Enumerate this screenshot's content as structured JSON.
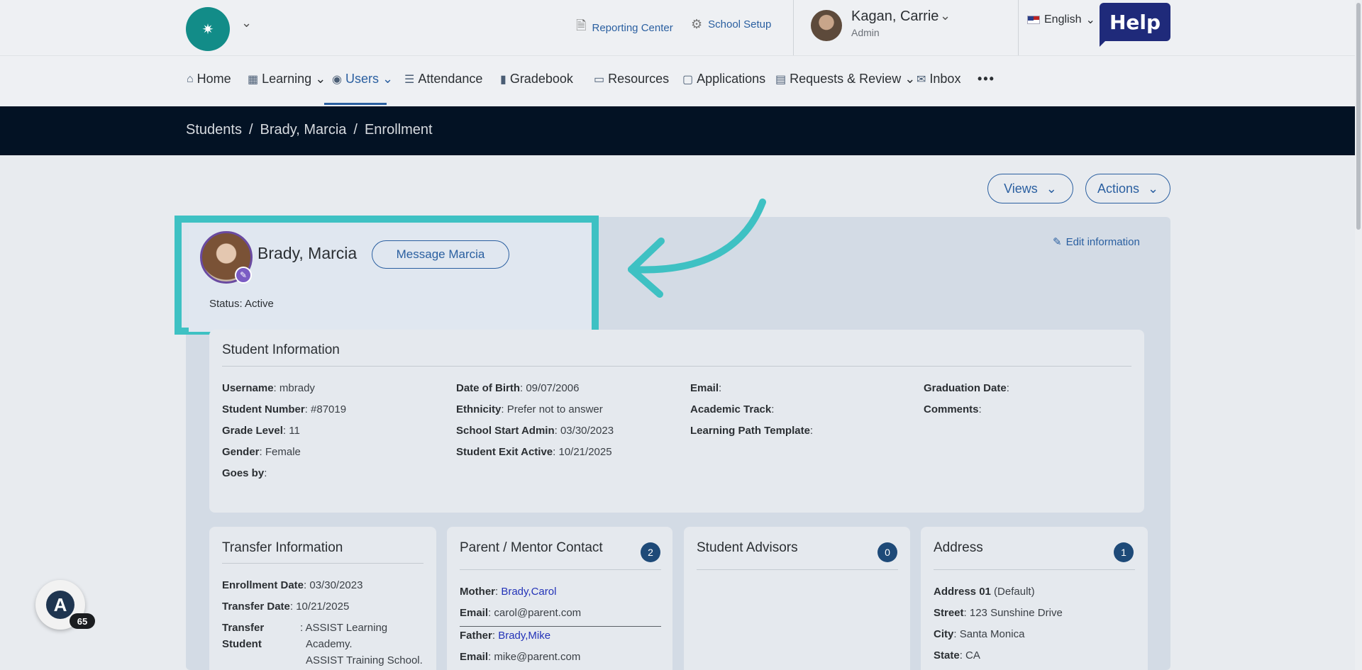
{
  "header": {
    "logo_glyph": "✷",
    "reporting_center": "Reporting Center",
    "school_setup": "School Setup",
    "user_name": "Kagan, Carrie",
    "user_role": "Admin",
    "language": "English",
    "help": "Help"
  },
  "nav": {
    "items": [
      {
        "label": "Home",
        "icon": "home-icon"
      },
      {
        "label": "Learning",
        "icon": "grid-icon"
      },
      {
        "label": "Users",
        "icon": "user-circle-icon"
      },
      {
        "label": "Attendance",
        "icon": "list-icon"
      },
      {
        "label": "Gradebook",
        "icon": "book-icon"
      },
      {
        "label": "Resources",
        "icon": "laptop-icon"
      },
      {
        "label": "Applications",
        "icon": "chat-icon"
      },
      {
        "label": "Requests & Review",
        "icon": "clipboard-icon"
      },
      {
        "label": "Inbox",
        "icon": "mail-icon"
      }
    ],
    "more": "•••",
    "active": "Users"
  },
  "breadcrumb": {
    "items": [
      "Students",
      "Brady, Marcia",
      "Enrollment"
    ],
    "separator": "/"
  },
  "toolbar": {
    "views": "Views",
    "actions": "Actions"
  },
  "profile": {
    "name": "Brady, Marcia",
    "message_button": "Message Marcia",
    "status": "Status: Active",
    "edit_information": "Edit information"
  },
  "student_info": {
    "title": "Student Information",
    "col1": [
      {
        "label": "Username",
        "value": "mbrady"
      },
      {
        "label": "Student Number",
        "value": "#87019"
      },
      {
        "label": "Grade Level",
        "value": "11"
      },
      {
        "label": "Gender",
        "value": "Female"
      },
      {
        "label": "Goes by",
        "value": ""
      }
    ],
    "col2": [
      {
        "label": "Date of Birth",
        "value": "09/07/2006"
      },
      {
        "label": "Ethnicity",
        "value": "Prefer not to answer"
      },
      {
        "label": "School Start Admin",
        "value": "03/30/2023"
      },
      {
        "label": "Student Exit Active",
        "value": "10/21/2025"
      }
    ],
    "col3": [
      {
        "label": "Email",
        "value": ""
      },
      {
        "label": "Academic Track",
        "value": ""
      },
      {
        "label": "Learning Path Template",
        "value": ""
      }
    ],
    "col4": [
      {
        "label": "Graduation Date",
        "value": ""
      },
      {
        "label": "Comments",
        "value": ""
      }
    ]
  },
  "transfer": {
    "title": "Transfer Information",
    "enrollment_label": "Enrollment Date",
    "enrollment_value": "03/30/2023",
    "transfer_label": "Transfer Date",
    "transfer_value": "10/21/2025",
    "transfer_student_label_1": "Transfer",
    "transfer_student_label_2": "Student",
    "transfer_student_value_1": ": ASSIST Learning",
    "transfer_student_value_2": "Academy.",
    "transfer_student_value_3": "ASSIST Training School."
  },
  "parents": {
    "title": "Parent / Mentor Contact",
    "count": "2",
    "mother_label": "Mother",
    "mother_name": "Brady,Carol",
    "mother_email_label": "Email",
    "mother_email": "carol@parent.com",
    "father_label": "Father",
    "father_name": "Brady,Mike",
    "father_email_label": "Email",
    "father_email": "mike@parent.com"
  },
  "advisors": {
    "title": "Student Advisors",
    "count": "0"
  },
  "address": {
    "title": "Address",
    "count": "1",
    "address_label": "Address 01",
    "address_note": "(Default)",
    "street_label": "Street",
    "street": "123 Sunshine Drive",
    "city_label": "City",
    "city": "Santa Monica",
    "state_label": "State",
    "state": "CA"
  },
  "widget": {
    "glyph": "A",
    "count": "65"
  },
  "colors": {
    "accent": "#2a5fa0",
    "highlight": "#3ec1c3",
    "dark_band": "#031224",
    "badge": "#1e4a78"
  }
}
